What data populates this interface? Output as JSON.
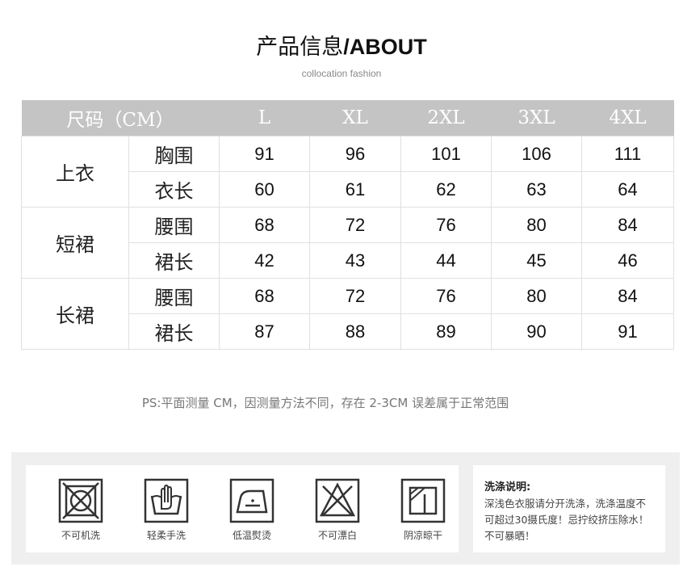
{
  "header": {
    "title_cn": "产品信息",
    "title_en": "/ABOUT",
    "subtitle": "collocation fashion"
  },
  "table": {
    "header_label": "尺码（CM）",
    "sizes": [
      "L",
      "XL",
      "2XL",
      "3XL",
      "4XL"
    ],
    "groups": [
      {
        "name": "上衣",
        "rows": [
          {
            "label": "胸围",
            "values": [
              "91",
              "96",
              "101",
              "106",
              "111"
            ]
          },
          {
            "label": "衣长",
            "values": [
              "60",
              "61",
              "62",
              "63",
              "64"
            ]
          }
        ]
      },
      {
        "name": "短裙",
        "rows": [
          {
            "label": "腰围",
            "values": [
              "68",
              "72",
              "76",
              "80",
              "84"
            ]
          },
          {
            "label": "裙长",
            "values": [
              "42",
              "43",
              "44",
              "45",
              "46"
            ]
          }
        ]
      },
      {
        "name": "长裙",
        "rows": [
          {
            "label": "腰围",
            "values": [
              "68",
              "72",
              "76",
              "80",
              "84"
            ]
          },
          {
            "label": "裙长",
            "values": [
              "87",
              "88",
              "89",
              "90",
              "91"
            ]
          }
        ]
      }
    ]
  },
  "note": "PS:平面测量 CM，因测量方法不同，存在 2-3CM 误差属于正常范围",
  "care": {
    "icons": [
      {
        "icon": "no-machine-wash-icon",
        "label": "不可机洗"
      },
      {
        "icon": "hand-wash-icon",
        "label": "轻柔手洗"
      },
      {
        "icon": "low-temp-iron-icon",
        "label": "低温熨烫"
      },
      {
        "icon": "no-bleach-icon",
        "label": "不可漂白"
      },
      {
        "icon": "shade-dry-icon",
        "label": "阴凉晾干"
      }
    ],
    "heading": "洗涤说明:",
    "body": "深浅色衣服请分开洗涤，洗涤温度不可超过30摄氏度！忌拧绞挤压除水！不可暴晒！"
  }
}
